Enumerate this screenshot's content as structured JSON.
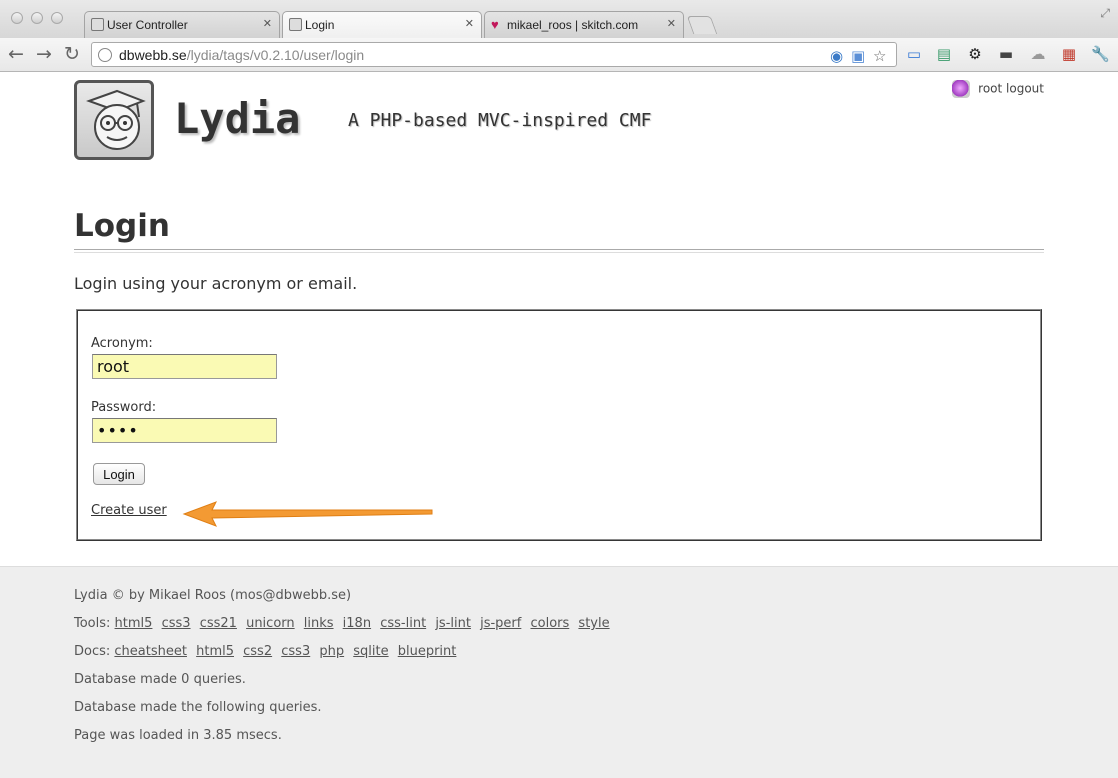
{
  "browser": {
    "tabs": [
      {
        "title": "User Controller",
        "favicon": "page-icon"
      },
      {
        "title": "Login",
        "favicon": "page-icon"
      },
      {
        "title": "mikael_roos | skitch.com",
        "favicon": "heart-icon"
      }
    ],
    "url_host": "dbwebb.se",
    "url_path": "/lydia/tags/v0.2.10/user/login"
  },
  "site": {
    "title": "Lydia",
    "slogan": "A PHP-based MVC-inspired CMF",
    "login_menu": {
      "user": "root",
      "logout": "logout"
    }
  },
  "page": {
    "title": "Login",
    "intro": "Login using your acronym or email."
  },
  "form": {
    "acronym_label": "Acronym:",
    "acronym_value": "root",
    "password_label": "Password:",
    "password_value": "••••",
    "submit_label": "Login",
    "create_user_label": "Create user"
  },
  "annotation": {
    "arrow_color": "#f39a33"
  },
  "footer": {
    "copyright": "Lydia © by Mikael Roos (mos@dbwebb.se)",
    "tools_label": "Tools:",
    "tools": [
      "html5",
      "css3",
      "css21",
      "unicorn",
      "links",
      "i18n",
      "css-lint",
      "js-lint",
      "js-perf",
      "colors",
      "style"
    ],
    "docs_label": "Docs:",
    "docs": [
      "cheatsheet",
      "html5",
      "css2",
      "css3",
      "php",
      "sqlite",
      "blueprint"
    ],
    "db_queries": "Database made 0 queries.",
    "db_following": "Database made the following queries.",
    "load_time": "Page was loaded in 3.85 msecs."
  }
}
